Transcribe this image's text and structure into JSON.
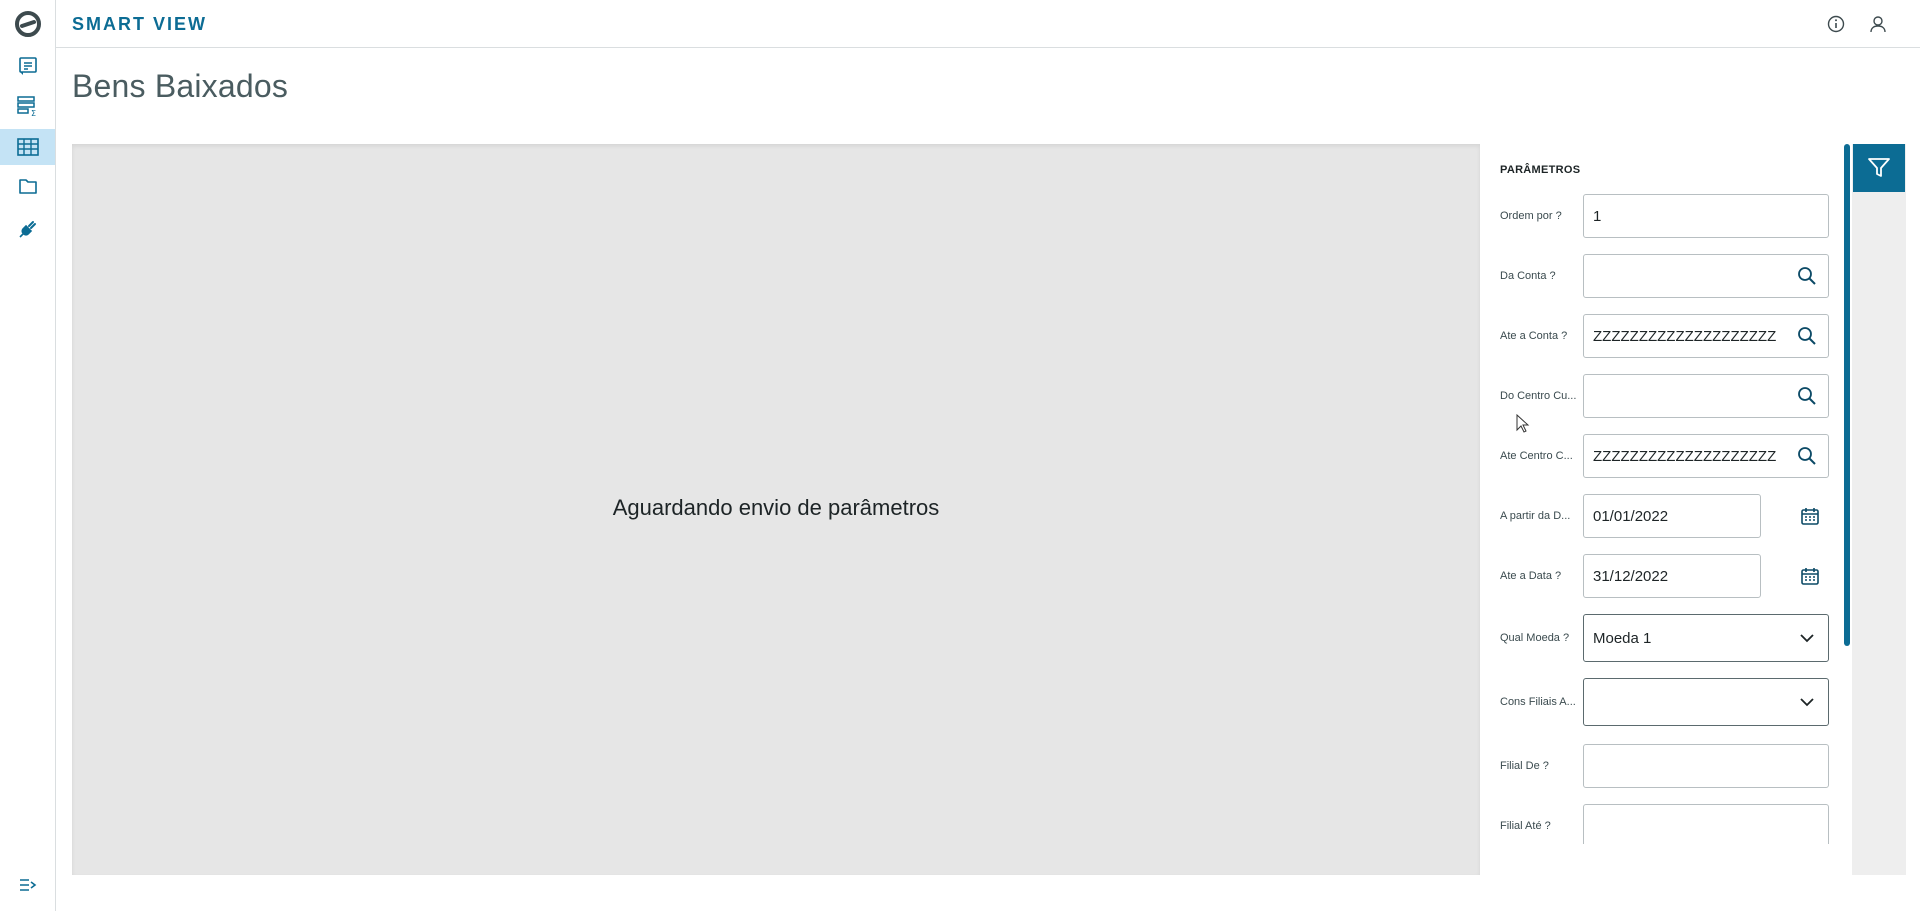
{
  "app": {
    "brand": "SMART VIEW"
  },
  "page": {
    "title": "Bens Baixados"
  },
  "report": {
    "message": "Aguardando envio de parâmetros"
  },
  "params": {
    "title": "PARÂMETROS",
    "fields": [
      {
        "label": "Ordem por ?",
        "value": "1",
        "kind": "text"
      },
      {
        "label": "Da Conta ?",
        "value": "",
        "kind": "lookup"
      },
      {
        "label": "Ate a Conta ?",
        "value": "ZZZZZZZZZZZZZZZZZZZZ",
        "kind": "lookup"
      },
      {
        "label": "Do Centro Cu...",
        "value": "",
        "kind": "lookup"
      },
      {
        "label": "Ate Centro C...",
        "value": "ZZZZZZZZZZZZZZZZZZZZ",
        "kind": "lookup"
      },
      {
        "label": "A partir da D...",
        "value": "01/01/2022",
        "kind": "date"
      },
      {
        "label": "Ate a Data ?",
        "value": "31/12/2022",
        "kind": "date"
      },
      {
        "label": "Qual Moeda ?",
        "value": "Moeda 1",
        "kind": "select"
      },
      {
        "label": "Cons Filiais A...",
        "value": "",
        "kind": "select"
      },
      {
        "label": "Filial De ?",
        "value": "",
        "kind": "text"
      },
      {
        "label": "Filial Até ?",
        "value": "",
        "kind": "text"
      }
    ]
  },
  "icons": {
    "rail": [
      "document-list-icon",
      "summary-table-icon",
      "table-grid-icon",
      "folder-icon",
      "plug-icon",
      "collapse-menu-icon"
    ],
    "top": [
      "info-icon",
      "user-icon"
    ],
    "panel": [
      "search-icon",
      "calendar-icon",
      "chevron-down-icon",
      "filter-icon"
    ]
  },
  "colors": {
    "accent": "#0c6c94",
    "active_rail": "#c4e3f5",
    "report_bg": "#e6e6e6"
  }
}
